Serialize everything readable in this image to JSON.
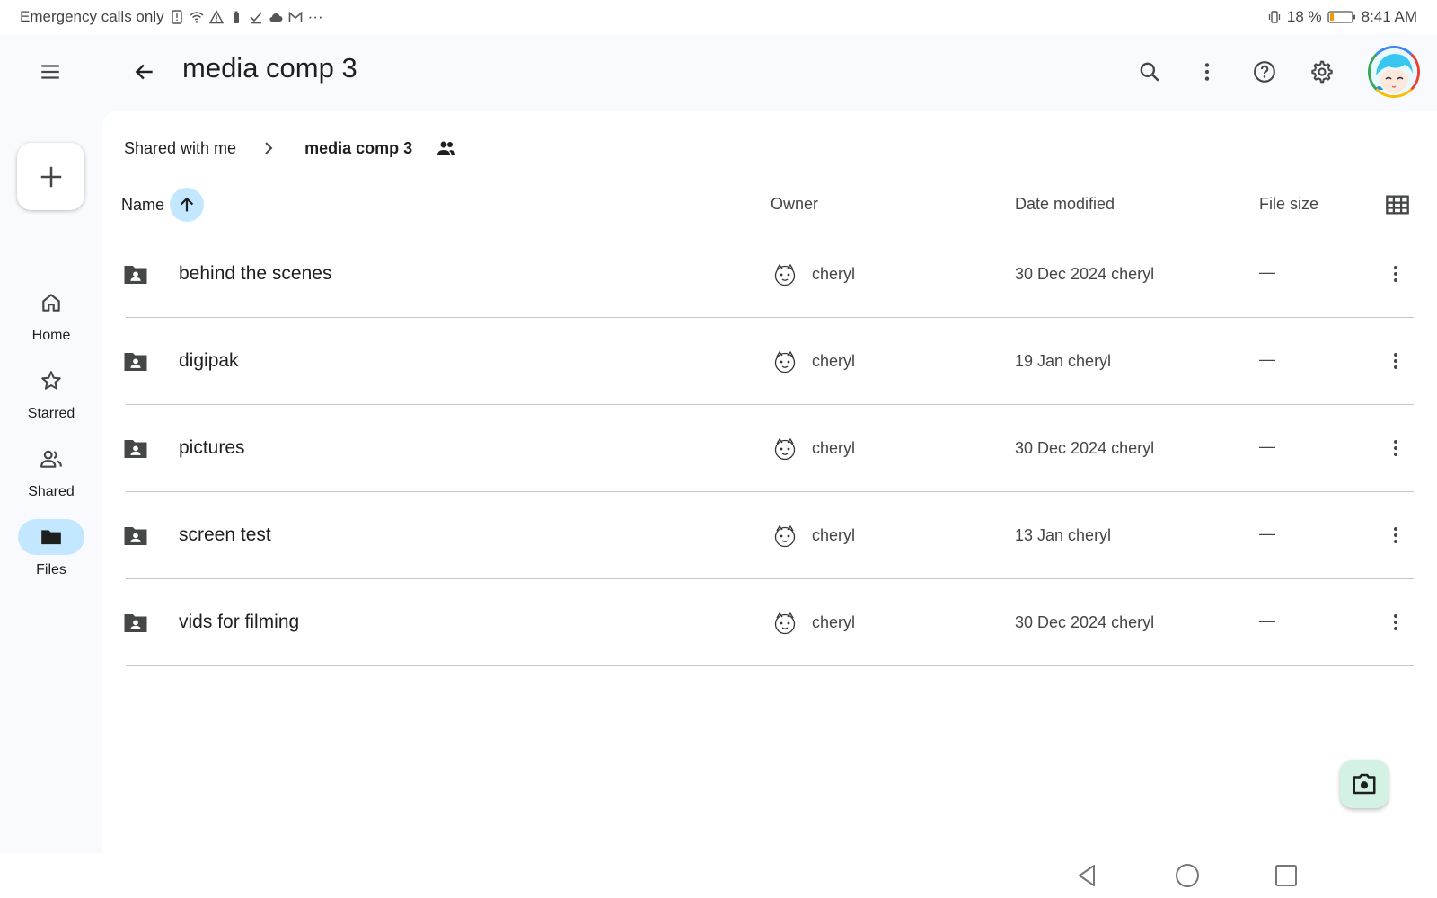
{
  "status_bar": {
    "left_text": "Emergency calls only",
    "left_icons": [
      "sim-alert-icon",
      "wifi-icon",
      "warning-icon",
      "battery-saver-icon",
      "check-icon",
      "cloud-icon",
      "gmail-icon",
      "more-notifications-icon"
    ],
    "overflow_text": "···",
    "battery_percent": "18 %",
    "battery_level": 0.18,
    "time": "8:41 AM"
  },
  "app_bar": {
    "title": "media comp 3",
    "icons": [
      "menu-icon",
      "back-arrow-icon",
      "search-icon",
      "more-vert-icon",
      "help-icon",
      "settings-icon",
      "account-avatar"
    ]
  },
  "sidebar": {
    "new_button_icon": "plus-icon",
    "items": [
      {
        "label": "Home",
        "icon": "home-icon",
        "active": false
      },
      {
        "label": "Starred",
        "icon": "star-icon",
        "active": false
      },
      {
        "label": "Shared",
        "icon": "people-icon",
        "active": false
      },
      {
        "label": "Files",
        "icon": "folder-icon",
        "active": true
      }
    ]
  },
  "breadcrumb": {
    "parent": "Shared with me",
    "current": "media comp 3",
    "shared_icon": "people-icon"
  },
  "table": {
    "columns": {
      "name": "Name",
      "owner": "Owner",
      "date_modified": "Date modified",
      "file_size": "File size"
    },
    "sort": "name-ascending",
    "rows": [
      {
        "name": "behind the scenes",
        "owner": "cheryl",
        "modified": "30 Dec 2024 cheryl",
        "size": "—"
      },
      {
        "name": "digipak",
        "owner": "cheryl",
        "modified": "19 Jan cheryl",
        "size": "—"
      },
      {
        "name": "pictures",
        "owner": "cheryl",
        "modified": "30 Dec 2024 cheryl",
        "size": "—"
      },
      {
        "name": "screen test",
        "owner": "cheryl",
        "modified": "13 Jan cheryl",
        "size": "—"
      },
      {
        "name": "vids for filming",
        "owner": "cheryl",
        "modified": "30 Dec 2024 cheryl",
        "size": "—"
      }
    ]
  },
  "fab": {
    "icon": "scan-camera-icon"
  },
  "colors": {
    "active_pill": "#c2e7ff",
    "scan_fab": "#d3f2e3",
    "background": "#f8fafd",
    "battery_low": "#f29900"
  }
}
